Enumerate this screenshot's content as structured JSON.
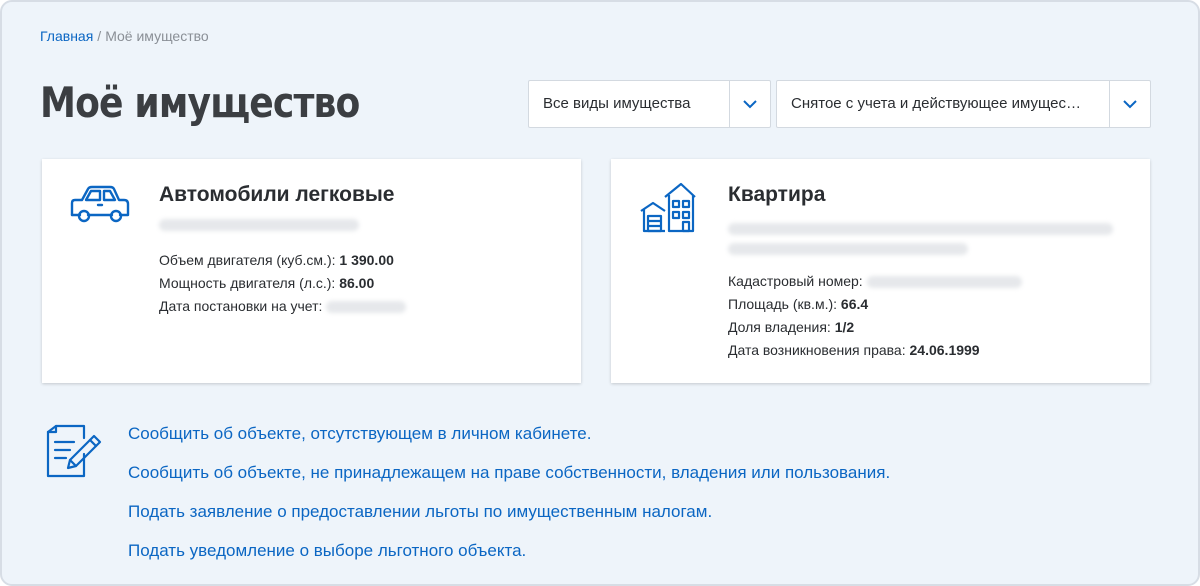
{
  "breadcrumb": {
    "home": "Главная",
    "separator": "/",
    "current": "Моё имущество"
  },
  "page_title": "Моё имущество",
  "filters": {
    "type": {
      "value": "Все виды имущества"
    },
    "status": {
      "value": "Снятое с учета и действующее имущес…"
    }
  },
  "cards": [
    {
      "icon": "car-icon",
      "title": "Автомобили легковые",
      "props": [
        {
          "label": "Объем двигателя (куб.см.): ",
          "value": "1 390.00"
        },
        {
          "label": "Мощность двигателя (л.с.): ",
          "value": "86.00"
        },
        {
          "label": "Дата постановки на учет: ",
          "value": ""
        }
      ]
    },
    {
      "icon": "house-icon",
      "title": "Квартира",
      "props": [
        {
          "label": "Кадастровый номер: ",
          "value": ""
        },
        {
          "label": "Площадь (кв.м.): ",
          "value": "66.4"
        },
        {
          "label": "Доля владения: ",
          "value": "1/2"
        },
        {
          "label": "Дата возникновения права: ",
          "value": "24.06.1999"
        }
      ]
    }
  ],
  "links": [
    "Сообщить об объекте, отсутствующем в личном кабинете.",
    "Сообщить об объекте, не принадлежащем на праве собственности, владения или пользования.",
    "Подать заявление о предоставлении льготы по имущественным налогам.",
    "Подать уведомление о выборе льготного объекта."
  ],
  "colors": {
    "accent": "#0b66c3",
    "background": "#eef4fa",
    "text": "#2a2d31",
    "title": "#3b3e42"
  }
}
